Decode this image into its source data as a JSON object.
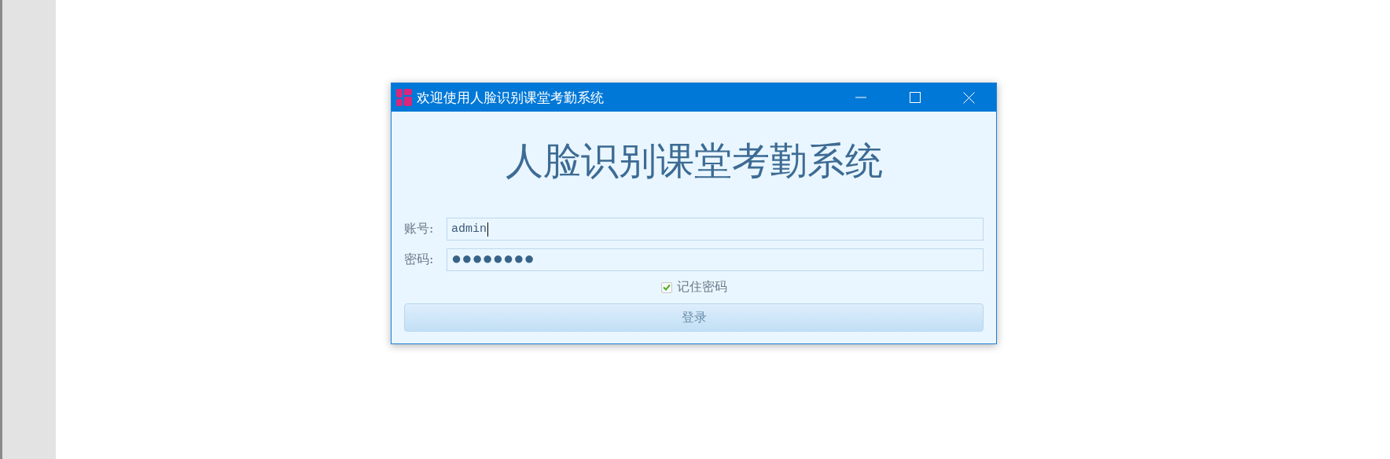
{
  "window": {
    "title": "欢迎使用人脸识别课堂考勤系统"
  },
  "heading": "人脸识别课堂考勤系统",
  "fields": [
    {
      "kind": "text",
      "label": "账号:",
      "value": "admin",
      "focused": true
    },
    {
      "kind": "password",
      "label": "密码:",
      "value": "●●●●●●●●",
      "focused": false
    }
  ],
  "remember": {
    "label": "记住密码",
    "checked": true
  },
  "buttons": [
    "登录"
  ]
}
